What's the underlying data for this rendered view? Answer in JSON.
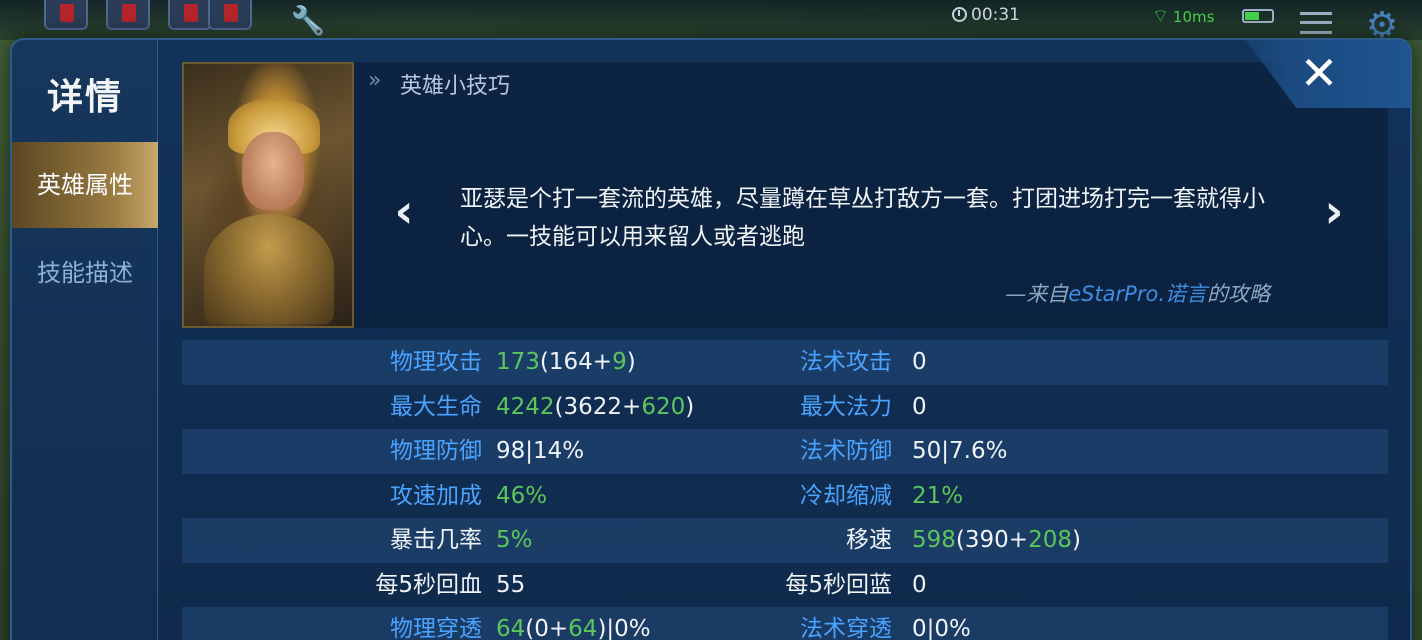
{
  "hud": {
    "timer": "00:31",
    "ping": "10ms"
  },
  "sidebar": {
    "title": "详情",
    "tabs": [
      {
        "label": "英雄属性",
        "active": true
      },
      {
        "label": "技能描述",
        "active": false
      }
    ]
  },
  "tips": {
    "title": "英雄小技巧",
    "body": "亚瑟是个打一套流的英雄，尽量蹲在草丛打敌方一套。打团进场打完一套就得小心。一技能可以用来留人或者逃跑",
    "source_prefix": "—来自",
    "source_author": "eStarPro.诺言",
    "source_suffix": "的攻略"
  },
  "colors": {
    "label_blue": "#4aa3ff",
    "value_green": "#5cc55c",
    "active_tab_gold": "#9a7c42"
  },
  "stats": [
    {
      "left": {
        "label": "物理攻击",
        "label_color": "blue",
        "parts": [
          [
            "g",
            "173"
          ],
          [
            "w",
            "(164+"
          ],
          [
            "g",
            "9"
          ],
          [
            "w",
            ")"
          ]
        ]
      },
      "right": {
        "label": "法术攻击",
        "label_color": "blue",
        "parts": [
          [
            "w",
            "0"
          ]
        ]
      }
    },
    {
      "left": {
        "label": "最大生命",
        "label_color": "blue",
        "parts": [
          [
            "g",
            "4242"
          ],
          [
            "w",
            "(3622+"
          ],
          [
            "g",
            "620"
          ],
          [
            "w",
            ")"
          ]
        ]
      },
      "right": {
        "label": "最大法力",
        "label_color": "blue",
        "parts": [
          [
            "w",
            "0"
          ]
        ]
      }
    },
    {
      "left": {
        "label": "物理防御",
        "label_color": "blue",
        "parts": [
          [
            "w",
            "98|14%"
          ]
        ]
      },
      "right": {
        "label": "法术防御",
        "label_color": "blue",
        "parts": [
          [
            "w",
            "50|7.6%"
          ]
        ]
      }
    },
    {
      "left": {
        "label": "攻速加成",
        "label_color": "blue",
        "parts": [
          [
            "g",
            "46%"
          ]
        ]
      },
      "right": {
        "label": "冷却缩减",
        "label_color": "blue",
        "parts": [
          [
            "g",
            "21%"
          ]
        ]
      }
    },
    {
      "left": {
        "label": "暴击几率",
        "label_color": "white",
        "parts": [
          [
            "g",
            "5%"
          ]
        ]
      },
      "right": {
        "label": "移速",
        "label_color": "white",
        "parts": [
          [
            "g",
            "598"
          ],
          [
            "w",
            "(390+"
          ],
          [
            "g",
            "208"
          ],
          [
            "w",
            ")"
          ]
        ]
      }
    },
    {
      "left": {
        "label": "每5秒回血",
        "label_color": "white",
        "parts": [
          [
            "w",
            "55"
          ]
        ]
      },
      "right": {
        "label": "每5秒回蓝",
        "label_color": "white",
        "parts": [
          [
            "w",
            "0"
          ]
        ]
      }
    },
    {
      "left": {
        "label": "物理穿透",
        "label_color": "blue",
        "parts": [
          [
            "g",
            "64"
          ],
          [
            "w",
            "(0+"
          ],
          [
            "g",
            "64"
          ],
          [
            "w",
            ")|0%"
          ]
        ]
      },
      "right": {
        "label": "法术穿透",
        "label_color": "blue",
        "parts": [
          [
            "w",
            "0|0%"
          ]
        ]
      }
    }
  ]
}
